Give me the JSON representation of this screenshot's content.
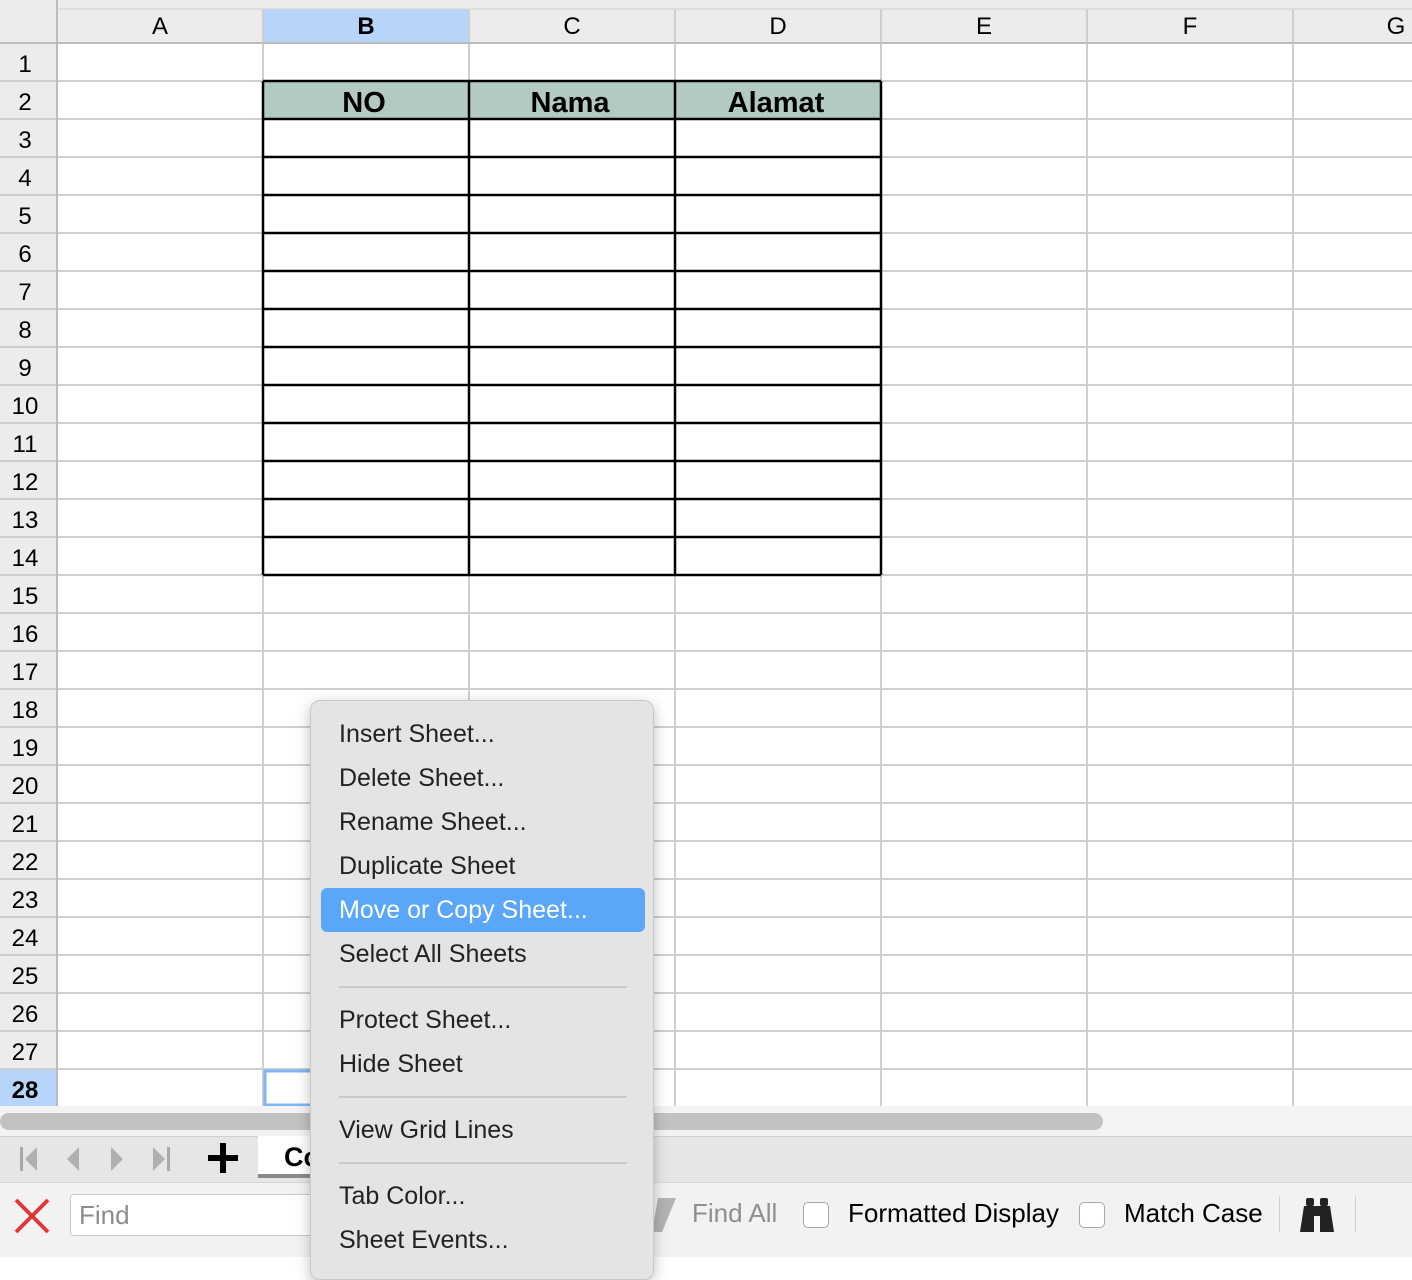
{
  "columns": [
    "A",
    "B",
    "C",
    "D",
    "E",
    "F",
    "G"
  ],
  "selected_column": "B",
  "rows": [
    "1",
    "2",
    "3",
    "4",
    "5",
    "6",
    "7",
    "8",
    "9",
    "10",
    "11",
    "12",
    "13",
    "14",
    "15",
    "16",
    "17",
    "18",
    "19",
    "20",
    "21",
    "22",
    "23",
    "24",
    "25",
    "26",
    "27",
    "28"
  ],
  "selected_row": "28",
  "table": {
    "headers": [
      "NO",
      "Nama",
      "Alamat"
    ],
    "header_fill": "#b3c9c4",
    "start_column": "B",
    "header_row": 2,
    "last_row": 14
  },
  "sheet_tab": {
    "label": "Co"
  },
  "find_bar": {
    "placeholder": "Find",
    "find_all_label": "Find All",
    "formatted_display_label": "Formatted Display",
    "match_case_label": "Match Case"
  },
  "context_menu": {
    "items": [
      "Insert Sheet...",
      "Delete Sheet...",
      "Rename Sheet...",
      "Duplicate Sheet",
      "Move or Copy Sheet...",
      "Select All Sheets",
      "Protect Sheet...",
      "Hide Sheet",
      "View Grid Lines",
      "Tab Color...",
      "Sheet Events..."
    ],
    "selected_item": "Move or Copy Sheet..."
  },
  "colors": {
    "selection_header": "#b7d5fa",
    "menu_highlight": "#5aa6f9",
    "close_icon": "#e0393b",
    "grid_line": "#cfcfcf"
  }
}
